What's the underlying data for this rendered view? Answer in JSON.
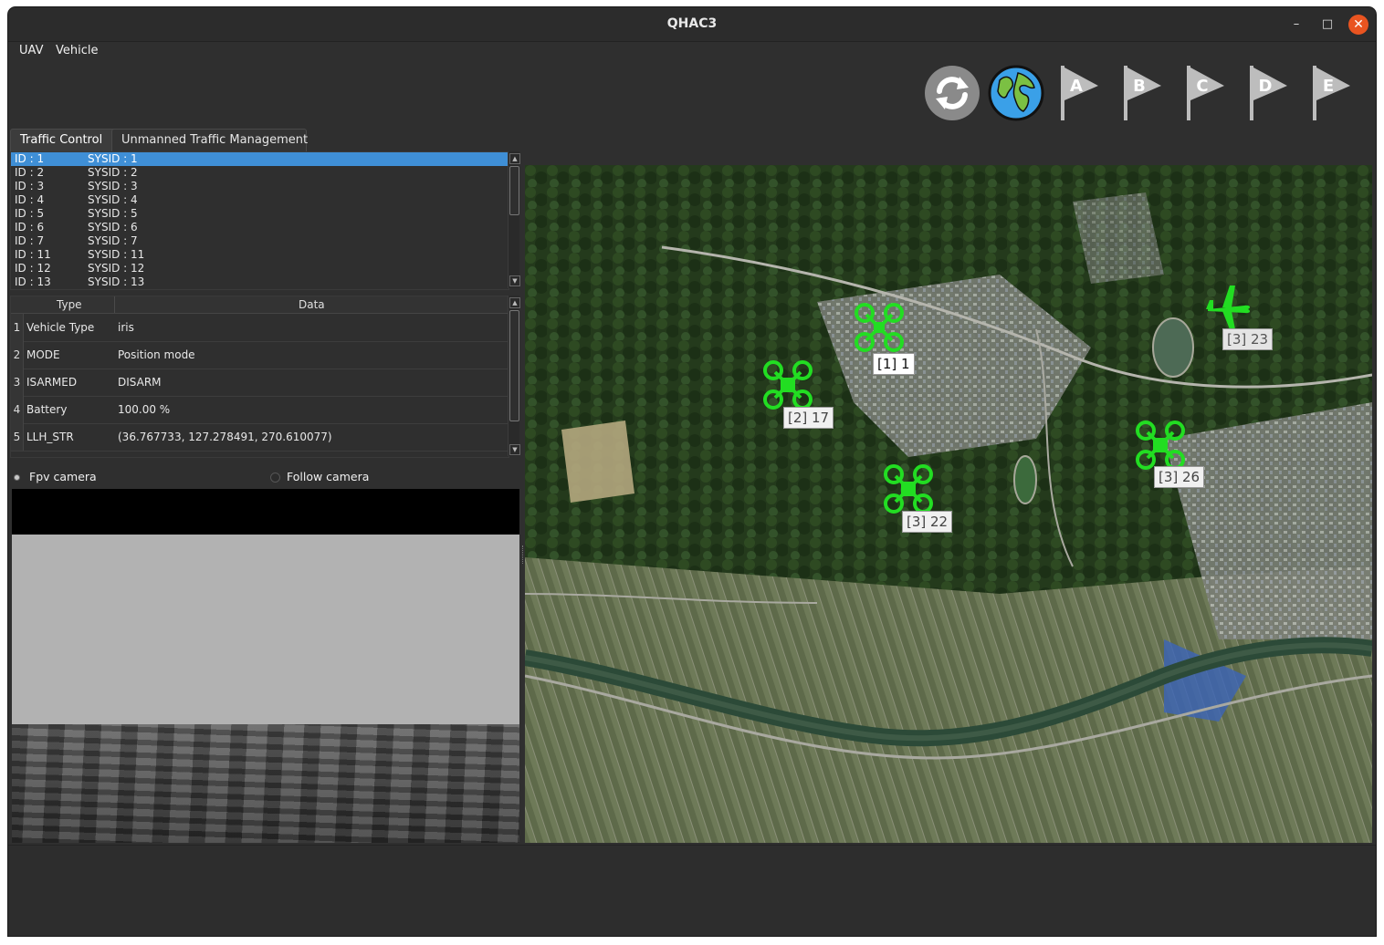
{
  "window": {
    "title": "QHAC3",
    "min_icon": "minimize-icon",
    "max_icon": "maximize-icon",
    "close_icon": "close-icon"
  },
  "menu": {
    "items": [
      "UAV",
      "Vehicle"
    ]
  },
  "toolbar": {
    "buttons": [
      {
        "name": "refresh",
        "icon": "refresh-icon"
      },
      {
        "name": "globe",
        "icon": "globe-icon"
      },
      {
        "name": "flag-a",
        "label": "A",
        "icon": "flag-icon"
      },
      {
        "name": "flag-b",
        "label": "B",
        "icon": "flag-icon"
      },
      {
        "name": "flag-c",
        "label": "C",
        "icon": "flag-icon"
      },
      {
        "name": "flag-d",
        "label": "D",
        "icon": "flag-icon"
      },
      {
        "name": "flag-e",
        "label": "E",
        "icon": "flag-icon"
      }
    ]
  },
  "tabs": [
    {
      "label": "Traffic Control",
      "active": true
    },
    {
      "label": "Unmanned Traffic Management",
      "active": false
    }
  ],
  "vehicle_list": [
    {
      "id": "ID : 1",
      "sysid": "SYSID : 1",
      "selected": true
    },
    {
      "id": "ID : 2",
      "sysid": "SYSID : 2"
    },
    {
      "id": "ID : 3",
      "sysid": "SYSID : 3"
    },
    {
      "id": "ID : 4",
      "sysid": "SYSID : 4"
    },
    {
      "id": "ID : 5",
      "sysid": "SYSID : 5"
    },
    {
      "id": "ID : 6",
      "sysid": "SYSID : 6"
    },
    {
      "id": "ID : 7",
      "sysid": "SYSID : 7"
    },
    {
      "id": "ID : 11",
      "sysid": "SYSID : 11"
    },
    {
      "id": "ID : 12",
      "sysid": "SYSID : 12"
    },
    {
      "id": "ID : 13",
      "sysid": "SYSID : 13"
    }
  ],
  "data_table": {
    "headers": [
      "Type",
      "Data"
    ],
    "rows": [
      {
        "num": "1",
        "type": "Vehicle Type",
        "data": "iris"
      },
      {
        "num": "2",
        "type": "MODE",
        "data": "Position mode"
      },
      {
        "num": "3",
        "type": "ISARMED",
        "data": "DISARM"
      },
      {
        "num": "4",
        "type": "Battery",
        "data": "100.00 %"
      },
      {
        "num": "5",
        "type": "LLH_STR",
        "data": "(36.767733, 127.278491, 270.610077)"
      }
    ]
  },
  "camera_options": {
    "fpv": {
      "label": "Fpv camera",
      "checked": true
    },
    "follow": {
      "label": "Follow camera",
      "checked": false
    }
  },
  "map": {
    "markers": [
      {
        "label": "[1] 1",
        "kind": "quadcopter-icon",
        "style": "white"
      },
      {
        "label": "[2] 17",
        "kind": "quadcopter-icon",
        "style": "light"
      },
      {
        "label": "[3] 22",
        "kind": "quadcopter-icon",
        "style": "light"
      },
      {
        "label": "[3] 26",
        "kind": "quadcopter-icon",
        "style": "light"
      },
      {
        "label": "[3] 23",
        "kind": "airplane-icon",
        "style": "faint"
      }
    ],
    "marker_color": "#22dd22"
  },
  "colors": {
    "selection": "#3f8fd6",
    "close_button": "#e95420"
  }
}
